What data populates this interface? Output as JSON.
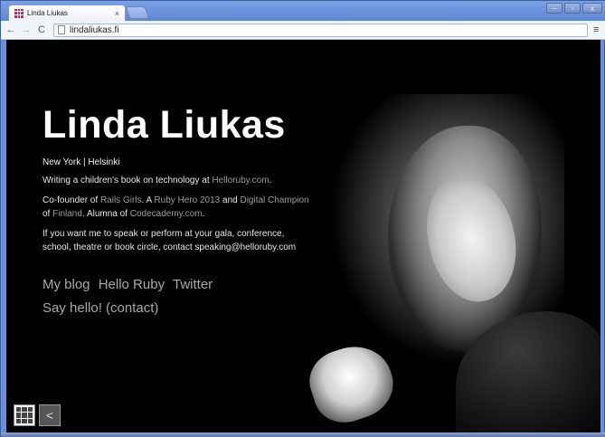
{
  "browser": {
    "tab_title": "Linda Liukas",
    "tab_close": "×",
    "url": "lindaliukas.fi",
    "back": "←",
    "forward": "→",
    "reload": "C",
    "menu": "≡",
    "win_minimize": "–",
    "win_restore": "▫",
    "win_close": "x"
  },
  "page": {
    "name": "Linda Liukas",
    "location": "New York | Helsinki",
    "writing_prefix": "Writing a children's book on technology at ",
    "writing_link": "Helloruby.com",
    "writing_suffix": ".",
    "cofounder_1": "Co-founder of ",
    "cofounder_link1": "Rails Girls",
    "cofounder_2": ". A ",
    "cofounder_link2": "Ruby Hero 2013",
    "cofounder_3": " and ",
    "cofounder_link3": "Digital Champion",
    "cofounder_4": " of ",
    "cofounder_link4": "Finland",
    "cofounder_5": ". Alumna of ",
    "cofounder_link5": "Codecademy.com",
    "cofounder_6": ".",
    "speaking_text": "If you want me to speak or perform at your gala, conference, school, theatre or book circle, contact speaking@helloruby.com",
    "nav": [
      "My blog",
      "Hello Ruby",
      "Twitter"
    ],
    "say_hello": "Say hello! (contact)",
    "back_widget": "<"
  },
  "colors": {
    "background": "#000000",
    "text": "#eaeaea",
    "link": "#9a9a9a"
  },
  "icons": [
    "grid-icon",
    "back-icon",
    "favicon-icon",
    "page-icon"
  ]
}
